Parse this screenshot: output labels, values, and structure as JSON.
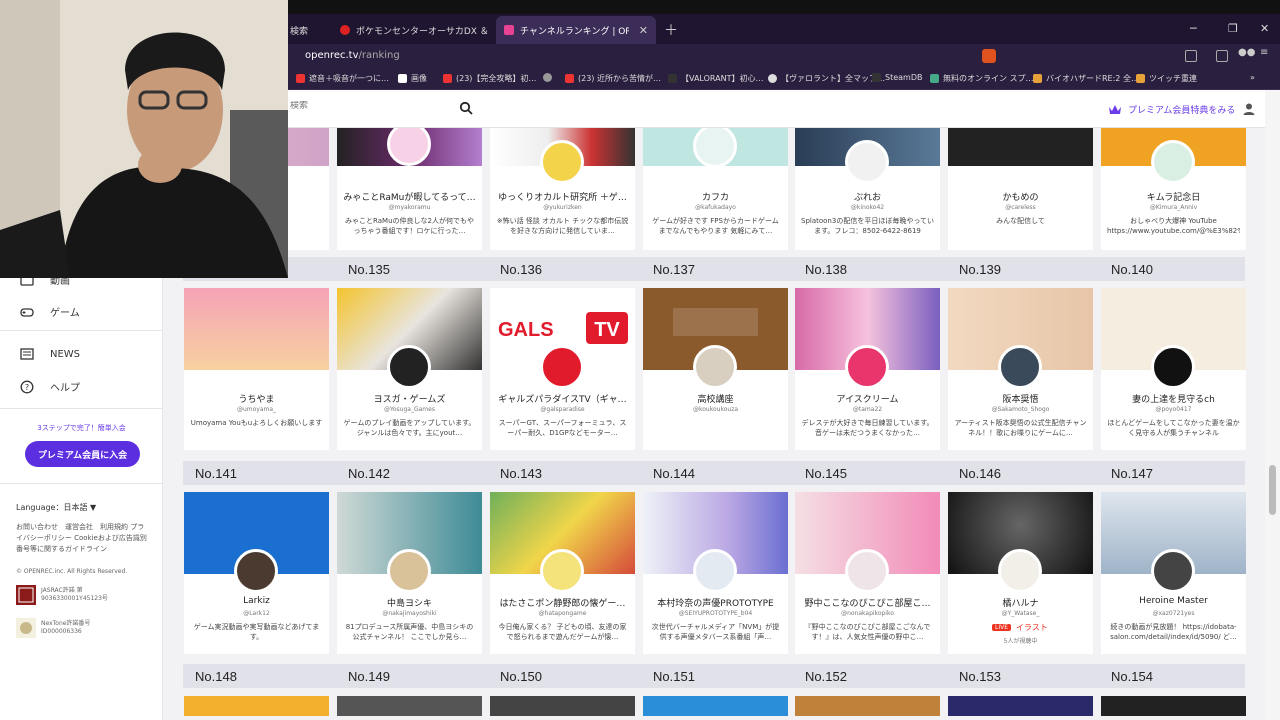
{
  "browser": {
    "tabs": [
      {
        "label": "ポケモンセンターオーサカDX ＆ ポケモンカフ",
        "active": false
      },
      {
        "label": "チャンネルランキング | OPENREC.tv |",
        "active": true
      }
    ],
    "partial_tab": "検索",
    "url_host": "openrec.tv",
    "url_path": "/ranking",
    "bookmarks": [
      "遮音＋吸音が一つに…",
      "画像",
      "(23)【完全攻略】初…",
      "",
      "(23) 近所から苦情が…",
      "【VALORANT】初心…",
      "【ヴァロラント】全マップ…",
      "SteamDB",
      "無料のオンライン スプ…",
      "バイオハザードRE:2 全…",
      "ツイッチ重連"
    ]
  },
  "header": {
    "search_placeholder": "検索",
    "premium_link": "プレミアム会員特典をみる"
  },
  "sidebar": {
    "items": [
      {
        "label": "動画",
        "icon": "video-icon"
      },
      {
        "label": "ゲーム",
        "icon": "gamepad-icon"
      },
      {
        "label": "NEWS",
        "icon": "news-icon"
      },
      {
        "label": "ヘルプ",
        "icon": "help-icon"
      }
    ],
    "steps_text": "3ステップで完了！簡単入会",
    "join_button": "プレミアム会員に入会",
    "language": "Language：日本語",
    "footer_links": "お問い合わせ　運営会社　利用規約 プライバシーポリシー Cookieおよび広告識別番号等に関するガイドライン",
    "copyright": "© OPENREC.inc. All Rights Reserved.",
    "jasrac": "JASRAC許諾 第9036330001Y45123号",
    "nextone": "NexTone許諾番号 ID000006336"
  },
  "top_row": [
    {
      "name": "",
      "handle": "",
      "desc": ""
    },
    {
      "name": "みゃことRaMuが暇してるって…",
      "handle": "@myakoramu",
      "desc": "みゃことRaMuの仲良しな2人が何でもやっちゃう番組です！ロケに行った…"
    },
    {
      "name": "ゆっくりオカルト研究所 ＋ゲ…",
      "handle": "@yukurizken",
      "desc": "※怖い話 怪談 オカルト チックな都市伝説 を好きな方向けに発信していま…"
    },
    {
      "name": "カフカ",
      "handle": "@kafukadayo",
      "desc": "ゲームが好きです FPSからカードゲームまでなんでもやります 気軽にみて…"
    },
    {
      "name": "ぶれお",
      "handle": "@kinoko42",
      "desc": "Splatoon3の配信を平日ほぼ毎晩やっています。フレコ：8502-6422-8619"
    },
    {
      "name": "かもめの",
      "handle": "@careless",
      "desc": "みんな配信して"
    },
    {
      "name": "キムラ記念日",
      "handle": "@Kimura_Anniv",
      "desc": "おしゃべり大爆神 YouTube https://www.youtube.com/@%E3%82%AD%E3…"
    }
  ],
  "ranks_row1": [
    "No.135",
    "No.136",
    "No.137",
    "No.138",
    "No.139",
    "No.140"
  ],
  "row1": [
    {
      "name": "うちやま",
      "handle": "@umoyama_",
      "desc": "Umoyama Youもuよろしくお願いします"
    },
    {
      "name": "ヨスガ・ゲームズ",
      "handle": "@Yosuga_Games",
      "desc": "ゲームのプレイ動画をアップしています。ジャンルは色々です。主にyout…"
    },
    {
      "name": "ギャルズパラダイスTV（ギャ…",
      "handle": "@galsparadise",
      "desc": "スーパーGT、スーパーフォーミュラ、スーパー耐久、D1GPなどモーター…"
    },
    {
      "name": "高校講座",
      "handle": "@koukoukouza",
      "desc": ""
    },
    {
      "name": "アイスクリーム",
      "handle": "@tama22",
      "desc": "デレステが大好きで毎日練習しています。音ゲーは未だつうまくなかった…"
    },
    {
      "name": "阪本奨悟",
      "handle": "@Sakamoto_Shogo",
      "desc": "アーティスト阪本奨悟の公式生配信チャンネル！！歌にお喋りにゲームに…"
    },
    {
      "name": "妻の上達を見守るch",
      "handle": "@poyo0417",
      "desc": "ほとんどゲームをしてこなかった妻を温かく見守る人が集うチャンネル"
    }
  ],
  "ranks_row2": [
    "No.141",
    "No.142",
    "No.143",
    "No.144",
    "No.145",
    "No.146",
    "No.147"
  ],
  "row2": [
    {
      "name": "Larkiz",
      "handle": "@Lark12",
      "desc": "ゲーム実況動画や実写動画などあげてます。"
    },
    {
      "name": "中島ヨシキ",
      "handle": "@nakajimayoshiki",
      "desc": "81プロデュース所属声優、中島ヨシキの公式チャンネル！ ここでしか見ら…"
    },
    {
      "name": "はたさこポン静野郎の懐ゲー…",
      "handle": "@hatapongame",
      "desc": "今日俺ん家くる？ 子どもの頃、友達の家で怒られるまで遊んだゲームが懐…"
    },
    {
      "name": "本村玲奈の声優PROTOTYPE",
      "handle": "@SEIYUPROTOTYPE_b04",
      "desc": "次世代バーチャルメディア「NVM」が提供する声優メタバース系番組「声…"
    },
    {
      "name": "野中ここなのぴこぴこ部屋こ…",
      "handle": "@nonakapikopiko",
      "desc": "『野中ここなのぴこぴこ部屋こごなんです！』は、人気女性声優の野中こ…"
    },
    {
      "name": "橘ハルナ",
      "handle": "@Y_Watase_",
      "desc": ""
    },
    {
      "name": "Heroine Master",
      "handle": "@xaz0721yes",
      "desc": "続きの動画が見放題！ https://idobata-salon.com/detail/index/id/5090/ ど…"
    }
  ],
  "live": {
    "badge": "LIVE",
    "tag": "イラスト",
    "viewers": "5人が視聴中"
  },
  "ranks_row3": [
    "No.148",
    "No.149",
    "No.150",
    "No.151",
    "No.152",
    "No.153",
    "No.154"
  ],
  "colors": {
    "accent": "#5b2fe0",
    "premium": "#6a3de8",
    "live": "#e32222"
  }
}
